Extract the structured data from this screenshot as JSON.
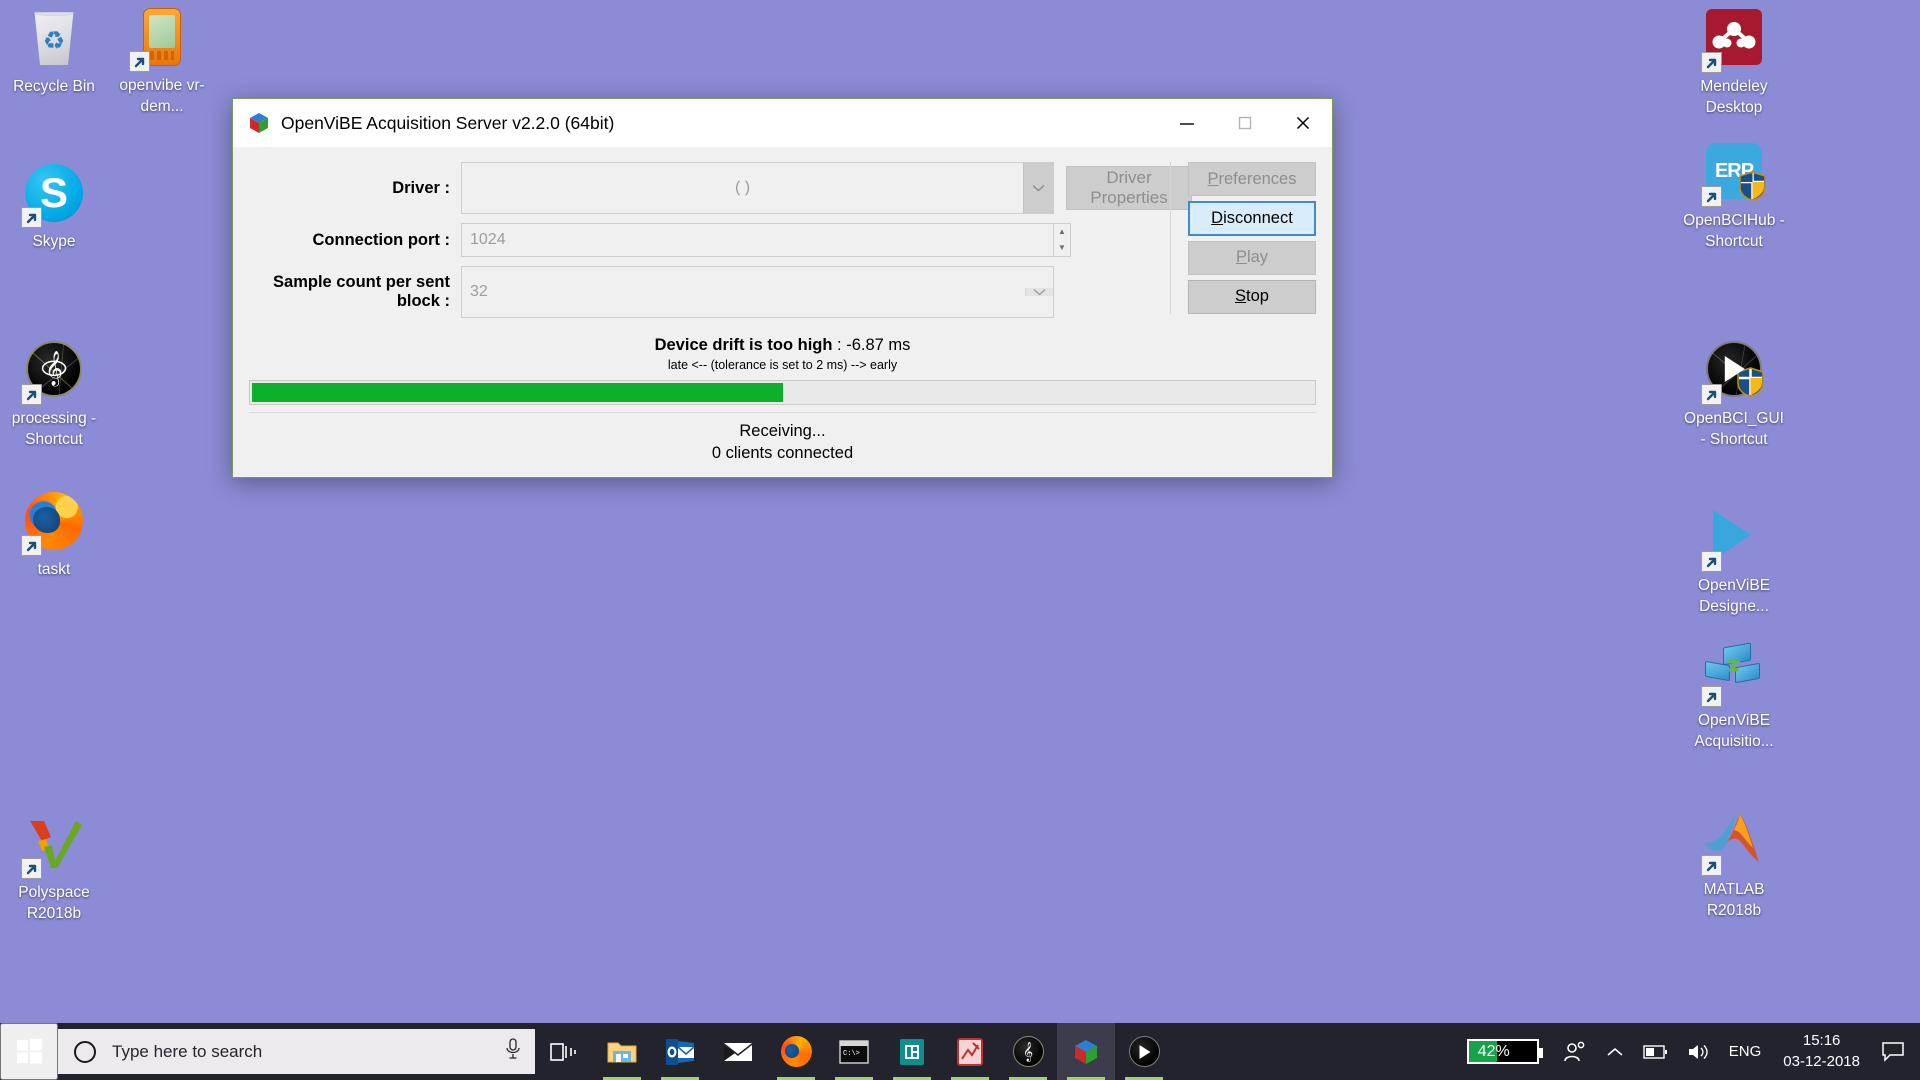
{
  "desktop": {
    "background_color": "#8b8bd6",
    "icons_left": [
      {
        "label": "Recycle Bin",
        "icon": "recycle-bin-icon",
        "shortcut": false
      },
      {
        "label": "openvibe vr-dem...",
        "icon": "pda-device-icon",
        "shortcut": true
      },
      {
        "label": "Skype",
        "icon": "skype-icon",
        "shortcut": true
      },
      {
        "label": "processing - Shortcut",
        "icon": "processing-icon",
        "shortcut": true
      },
      {
        "label": "taskt",
        "icon": "firefox-icon",
        "shortcut": true
      },
      {
        "label": "Polyspace R2018b",
        "icon": "polyspace-icon",
        "shortcut": true
      }
    ],
    "icons_right": [
      {
        "label": "Mendeley Desktop",
        "icon": "mendeley-icon",
        "shortcut": true
      },
      {
        "label": "OpenBCIHub - Shortcut",
        "icon": "openbcihub-icon",
        "shortcut": true
      },
      {
        "label": "OpenBCI_GUI - Shortcut",
        "icon": "openbci-gui-icon",
        "shortcut": true
      },
      {
        "label": "OpenViBE Designe...",
        "icon": "openvibe-designer-icon",
        "shortcut": true
      },
      {
        "label": "OpenViBE Acquisitio...",
        "icon": "openvibe-acquisition-icon",
        "shortcut": true
      },
      {
        "label": "MATLAB R2018b",
        "icon": "matlab-icon",
        "shortcut": true
      }
    ]
  },
  "window": {
    "title": "OpenViBE Acquisition Server v2.2.0 (64bit)",
    "icon": "openvibe-cube-icon",
    "controls": {
      "minimize": "minimize-icon",
      "maximize": "maximize-icon",
      "close": "close-icon"
    },
    "form": {
      "driver_label": "Driver :",
      "driver_value": "(     )",
      "driver_properties_label": "Driver Properties",
      "connection_port_label": "Connection port :",
      "connection_port_value": "1024",
      "sample_count_label": "Sample count per sent block :",
      "sample_count_value": "32"
    },
    "buttons": {
      "preferences": "Preferences",
      "preferences_accel": "P",
      "disconnect": "Disconnect",
      "disconnect_accel": "D",
      "play": "Play",
      "play_accel": "P",
      "stop": "Stop",
      "stop_accel": "S"
    },
    "status": {
      "drift_label": "Device drift is too high",
      "drift_value": ": -6.87 ms",
      "tolerance_text": "late <-- (tolerance is set to 2 ms) --> early",
      "progress_percent": 50,
      "progress_color": "#0db02b",
      "state": "Receiving...",
      "clients": "0 clients connected"
    }
  },
  "taskbar": {
    "start_icon": "windows-start-icon",
    "search_placeholder": "Type here to search",
    "search_icon": "cortana-circle-icon",
    "mic_icon": "microphone-icon",
    "apps": [
      {
        "name": "task-view-icon",
        "running": false,
        "active": false
      },
      {
        "name": "file-explorer-icon",
        "running": true,
        "active": false
      },
      {
        "name": "outlook-icon",
        "running": true,
        "active": false
      },
      {
        "name": "mail-icon",
        "running": false,
        "active": false
      },
      {
        "name": "firefox-icon",
        "running": true,
        "active": false
      },
      {
        "name": "command-prompt-icon",
        "running": true,
        "active": false
      },
      {
        "name": "teal-app-icon",
        "running": true,
        "active": false
      },
      {
        "name": "matlab-app-icon",
        "running": true,
        "active": false
      },
      {
        "name": "processing-app-icon",
        "running": true,
        "active": false
      },
      {
        "name": "openvibe-app-icon",
        "running": true,
        "active": true
      },
      {
        "name": "openbci-app-icon",
        "running": true,
        "active": false
      }
    ],
    "tray": {
      "battery_percent": "42%",
      "battery_fill": 42,
      "people_icon": "people-icon",
      "show_hidden_icon": "chevron-up-icon",
      "battery_icon": "battery-icon",
      "volume_icon": "volume-icon",
      "language": "ENG",
      "time": "15:16",
      "date": "03-12-2018",
      "notifications_icon": "notification-icon"
    }
  }
}
